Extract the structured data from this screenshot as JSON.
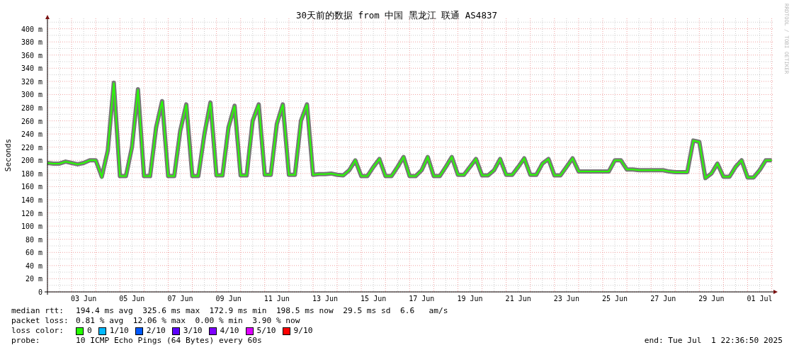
{
  "chart": {
    "credit": "RRDTOOL / TOBI OETIKER",
    "chart_data": {
      "type": "line",
      "title": "30天前的数据 from 中国 黑龙江 联通 AS4837",
      "ylabel": "Seconds",
      "categories": [
        null,
        null,
        null,
        null,
        null,
        null,
        "03 Jun",
        null,
        null,
        null,
        null,
        null,
        null,
        null,
        "05 Jun",
        null,
        null,
        null,
        null,
        null,
        null,
        null,
        "07 Jun",
        null,
        null,
        null,
        null,
        null,
        null,
        null,
        "09 Jun",
        null,
        null,
        null,
        null,
        null,
        null,
        null,
        "11 Jun",
        null,
        null,
        null,
        null,
        null,
        null,
        null,
        "13 Jun",
        null,
        null,
        null,
        null,
        null,
        null,
        null,
        "15 Jun",
        null,
        null,
        null,
        null,
        null,
        null,
        null,
        "17 Jun",
        null,
        null,
        null,
        null,
        null,
        null,
        null,
        "19 Jun",
        null,
        null,
        null,
        null,
        null,
        null,
        null,
        "21 Jun",
        null,
        null,
        null,
        null,
        null,
        null,
        null,
        "23 Jun",
        null,
        null,
        null,
        null,
        null,
        null,
        null,
        "25 Jun",
        null,
        null,
        null,
        null,
        null,
        null,
        null,
        "27 Jun",
        null,
        null,
        null,
        null,
        null,
        null,
        null,
        "29 Jun",
        null,
        null,
        null,
        null,
        null,
        null,
        null,
        "01 Jul",
        null,
        null
      ],
      "series": [
        {
          "color": "#26ff00",
          "values": [
            196,
            195,
            195,
            198,
            196,
            194,
            196,
            200,
            200,
            175,
            215,
            318,
            176,
            176,
            220,
            308,
            176,
            176,
            250,
            290,
            176,
            176,
            245,
            285,
            176,
            176,
            240,
            288,
            177,
            177,
            250,
            283,
            177,
            177,
            260,
            285,
            178,
            178,
            255,
            285,
            178,
            178,
            260,
            285,
            178,
            179,
            179,
            180,
            178,
            177,
            185,
            200,
            176,
            176,
            190,
            202,
            176,
            176,
            190,
            205,
            176,
            176,
            185,
            205,
            176,
            176,
            190,
            205,
            178,
            178,
            190,
            202,
            177,
            177,
            185,
            202,
            178,
            178,
            190,
            203,
            178,
            178,
            195,
            202,
            177,
            177,
            190,
            203,
            183,
            183,
            183,
            183,
            183,
            183,
            200,
            200,
            186,
            186,
            185,
            185,
            185,
            185,
            185,
            183,
            182,
            182,
            182,
            230,
            228,
            173,
            180,
            195,
            175,
            175,
            190,
            200,
            174,
            174,
            185,
            200,
            200
          ]
        }
      ],
      "grid": true,
      "ylim": [
        0,
        420
      ],
      "yticks": [
        {
          "value": 0,
          "label": "0"
        },
        {
          "value": 20,
          "label": "20 m"
        },
        {
          "value": 40,
          "label": "40 m"
        },
        {
          "value": 60,
          "label": "60 m"
        },
        {
          "value": 80,
          "label": "80 m"
        },
        {
          "value": 100,
          "label": "100 m"
        },
        {
          "value": 120,
          "label": "120 m"
        },
        {
          "value": 140,
          "label": "140 m"
        },
        {
          "value": 160,
          "label": "160 m"
        },
        {
          "value": 180,
          "label": "180 m"
        },
        {
          "value": 200,
          "label": "200 m"
        },
        {
          "value": 220,
          "label": "220 m"
        },
        {
          "value": 240,
          "label": "240 m"
        },
        {
          "value": 260,
          "label": "260 m"
        },
        {
          "value": 280,
          "label": "280 m"
        },
        {
          "value": 300,
          "label": "300 m"
        },
        {
          "value": 320,
          "label": "320 m"
        },
        {
          "value": 340,
          "label": "340 m"
        },
        {
          "value": 360,
          "label": "360 m"
        },
        {
          "value": 380,
          "label": "380 m"
        },
        {
          "value": 400,
          "label": "400 m"
        }
      ]
    }
  },
  "stats": [
    {
      "label": "median rtt:",
      "value": "194.4 ms avg  325.6 ms max  172.9 ms min  198.5 ms now  29.5 ms sd  6.6   am/s"
    },
    {
      "label": "packet loss:",
      "value": "0.81 % avg  12.06 % max  0.00 % min  3.90 % now"
    }
  ],
  "loss_legend": {
    "label": "loss color:",
    "items": [
      {
        "label": "0",
        "color": "#26ff00"
      },
      {
        "label": "1/10",
        "color": "#00b8ff"
      },
      {
        "label": "2/10",
        "color": "#0059ff"
      },
      {
        "label": "3/10",
        "color": "#5e00ff"
      },
      {
        "label": "4/10",
        "color": "#7e00ff"
      },
      {
        "label": "5/10",
        "color": "#dd00ff"
      },
      {
        "label": "9/10",
        "color": "#ff0000"
      }
    ]
  },
  "probe": {
    "label": "probe:",
    "value": "10 ICMP Echo Pings (64 Bytes) every 60s"
  },
  "end": "end: Tue Jul  1 22:36:50 2025"
}
